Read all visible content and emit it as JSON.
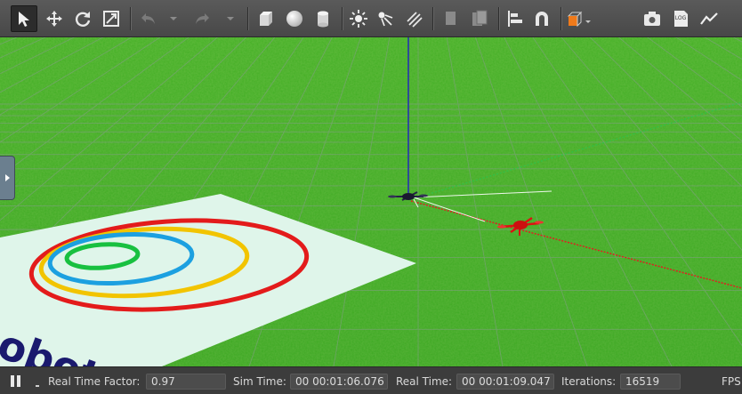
{
  "toolbar": {
    "tools": [
      {
        "name": "select-mode",
        "icon": "arrow-pointer-icon",
        "active": true
      },
      {
        "name": "translate-mode",
        "icon": "move-arrows-icon"
      },
      {
        "name": "rotate-mode",
        "icon": "rotate-icon"
      },
      {
        "name": "scale-mode",
        "icon": "scale-icon"
      },
      {
        "name": "undo",
        "icon": "undo-icon"
      },
      {
        "name": "undo-history",
        "icon": "chevron-down-icon"
      },
      {
        "name": "redo",
        "icon": "redo-icon"
      },
      {
        "name": "redo-history",
        "icon": "chevron-down-icon"
      },
      {
        "name": "box-shape",
        "icon": "cube-icon"
      },
      {
        "name": "sphere-shape",
        "icon": "sphere-icon"
      },
      {
        "name": "cylinder-shape",
        "icon": "cylinder-icon"
      },
      {
        "name": "point-light",
        "icon": "sun-icon"
      },
      {
        "name": "spot-light",
        "icon": "spotlight-icon"
      },
      {
        "name": "directional-light",
        "icon": "directional-light-icon"
      },
      {
        "name": "copy",
        "icon": "copy-icon"
      },
      {
        "name": "paste",
        "icon": "paste-icon"
      },
      {
        "name": "align",
        "icon": "align-icon"
      },
      {
        "name": "snap",
        "icon": "magnet-icon"
      },
      {
        "name": "view-angle",
        "icon": "orange-cube-icon"
      },
      {
        "name": "screenshot",
        "icon": "camera-icon"
      },
      {
        "name": "log",
        "icon": "log-icon",
        "text": "LOG"
      },
      {
        "name": "plot",
        "icon": "line-plot-icon"
      }
    ]
  },
  "scene": {
    "ground_color": "#3fae23",
    "grid_color": "#7a9a7a",
    "axis_colors": {
      "x": "#e02020",
      "y": "#2fc24a",
      "z": "#2020c0"
    },
    "drones": [
      {
        "name": "dark-quadcopter",
        "color": "#222244"
      },
      {
        "name": "red-quadcopter",
        "color": "#dd1111"
      }
    ],
    "target_pad": {
      "color": "#dff5ea",
      "ring_colors": [
        "#e31b1b",
        "#f2c400",
        "#1ca0e0",
        "#18c040"
      ],
      "text": "obot",
      "text_color": "#1a1a6e"
    }
  },
  "status": {
    "pause_icon": "pause-icon",
    "real_time_factor_label": "Real Time Factor:",
    "real_time_factor": "0.97",
    "sim_time_label": "Sim Time:",
    "sim_time": "00 00:01:06.076",
    "real_time_label": "Real Time:",
    "real_time": "00 00:01:09.047",
    "iterations_label": "Iterations:",
    "iterations": "16519",
    "fps_label": "FPS"
  }
}
